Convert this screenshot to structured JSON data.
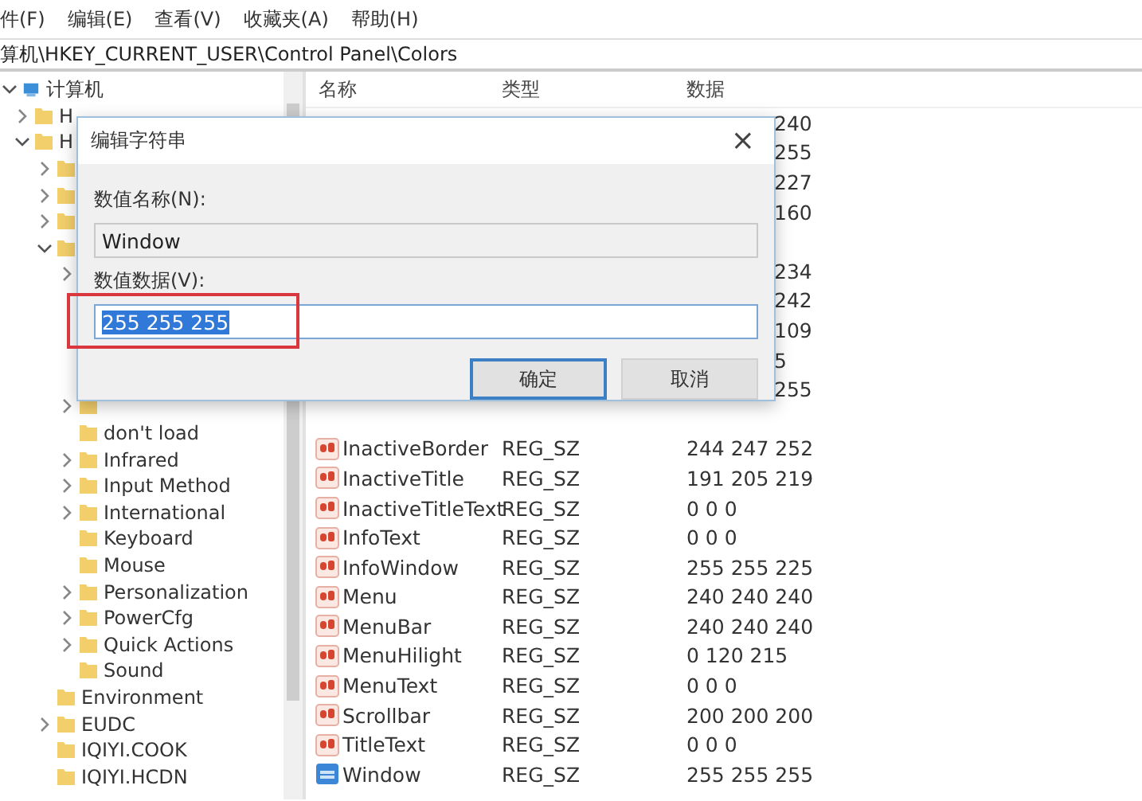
{
  "menu": [
    "件(F)",
    "编辑(E)",
    "查看(V)",
    "收藏夹(A)",
    "帮助(H)"
  ],
  "address": "算机\\HKEY_CURRENT_USER\\Control Panel\\Colors",
  "tree": [
    {
      "label": "计算机",
      "kind": "branch",
      "expanded": true,
      "children": [
        {
          "label": "H",
          "kind": "branch",
          "expanded": false
        },
        {
          "label": "H",
          "kind": "branch",
          "expanded": true,
          "children": [
            {
              "kind": "branch",
              "expanded": false
            },
            {
              "kind": "branch",
              "expanded": false
            },
            {
              "kind": "branch",
              "expanded": false
            },
            {
              "kind": "branch",
              "expanded": true,
              "children": [
                {
                  "kind": "covered_branch",
                  "expanded": false
                },
                {
                  "kind": "covered"
                },
                {
                  "kind": "covered"
                },
                {
                  "kind": "covered"
                },
                {
                  "kind": "covered"
                },
                {
                  "kind": "branch",
                  "expanded": false
                },
                {
                  "label": "don't load",
                  "kind": "leaf"
                },
                {
                  "label": "Infrared",
                  "kind": "branch",
                  "expanded": false
                },
                {
                  "label": "Input Method",
                  "kind": "branch",
                  "expanded": false
                },
                {
                  "label": "International",
                  "kind": "branch",
                  "expanded": false
                },
                {
                  "label": "Keyboard",
                  "kind": "leaf"
                },
                {
                  "label": "Mouse",
                  "kind": "leaf"
                },
                {
                  "label": "Personalization",
                  "kind": "branch",
                  "expanded": false
                },
                {
                  "label": "PowerCfg",
                  "kind": "branch",
                  "expanded": false
                },
                {
                  "label": "Quick Actions",
                  "kind": "branch",
                  "expanded": false
                },
                {
                  "label": "Sound",
                  "kind": "leaf"
                }
              ]
            },
            {
              "label": "Environment",
              "kind": "leaf"
            },
            {
              "label": "EUDC",
              "kind": "branch",
              "expanded": false
            },
            {
              "label": "IQIYI.COOK",
              "kind": "leaf"
            },
            {
              "label": "IQIYI.HCDN",
              "kind": "leaf"
            }
          ]
        }
      ]
    }
  ],
  "list": {
    "columns": [
      "名称",
      "类型",
      "数据"
    ],
    "rows": [
      {
        "kind": "covered",
        "data": "240"
      },
      {
        "kind": "covered",
        "data": "255"
      },
      {
        "kind": "covered",
        "data": "227"
      },
      {
        "kind": "covered",
        "data": "160"
      },
      {
        "kind": "covered"
      },
      {
        "kind": "covered",
        "data": "234"
      },
      {
        "kind": "covered",
        "data": "242"
      },
      {
        "kind": "covered",
        "data": "109"
      },
      {
        "kind": "covered",
        "data": "5"
      },
      {
        "kind": "covered",
        "data": "255"
      },
      {
        "kind": "covered"
      },
      {
        "kind": "value",
        "name": "InactiveBorder",
        "type": "REG_SZ",
        "data": "244 247 252",
        "selected": false
      },
      {
        "kind": "value",
        "name": "InactiveTitle",
        "type": "REG_SZ",
        "data": "191 205 219",
        "selected": false
      },
      {
        "kind": "value",
        "name": "InactiveTitleText",
        "type": "REG_SZ",
        "data": "0 0 0",
        "selected": false
      },
      {
        "kind": "value",
        "name": "InfoText",
        "type": "REG_SZ",
        "data": "0 0 0",
        "selected": false
      },
      {
        "kind": "value",
        "name": "InfoWindow",
        "type": "REG_SZ",
        "data": "255 255 225",
        "selected": false
      },
      {
        "kind": "value",
        "name": "Menu",
        "type": "REG_SZ",
        "data": "240 240 240",
        "selected": false
      },
      {
        "kind": "value",
        "name": "MenuBar",
        "type": "REG_SZ",
        "data": "240 240 240",
        "selected": false
      },
      {
        "kind": "value",
        "name": "MenuHilight",
        "type": "REG_SZ",
        "data": "0 120 215",
        "selected": false
      },
      {
        "kind": "value",
        "name": "MenuText",
        "type": "REG_SZ",
        "data": "0 0 0",
        "selected": false
      },
      {
        "kind": "value",
        "name": "Scrollbar",
        "type": "REG_SZ",
        "data": "200 200 200",
        "selected": false
      },
      {
        "kind": "value",
        "name": "TitleText",
        "type": "REG_SZ",
        "data": "0 0 0",
        "selected": false
      },
      {
        "kind": "value",
        "name": "Window",
        "type": "REG_SZ",
        "data": "255 255 255",
        "selected": true
      }
    ]
  },
  "dialog": {
    "title": "编辑字符串",
    "close": "×",
    "name_label": "数值名称(N):",
    "name_value": "Window",
    "data_label": "数值数据(V):",
    "data_value": "255 255 255",
    "data_selected": true,
    "buttons": [
      {
        "label": "确定",
        "default": true
      },
      {
        "label": "取消",
        "default": false
      }
    ]
  }
}
